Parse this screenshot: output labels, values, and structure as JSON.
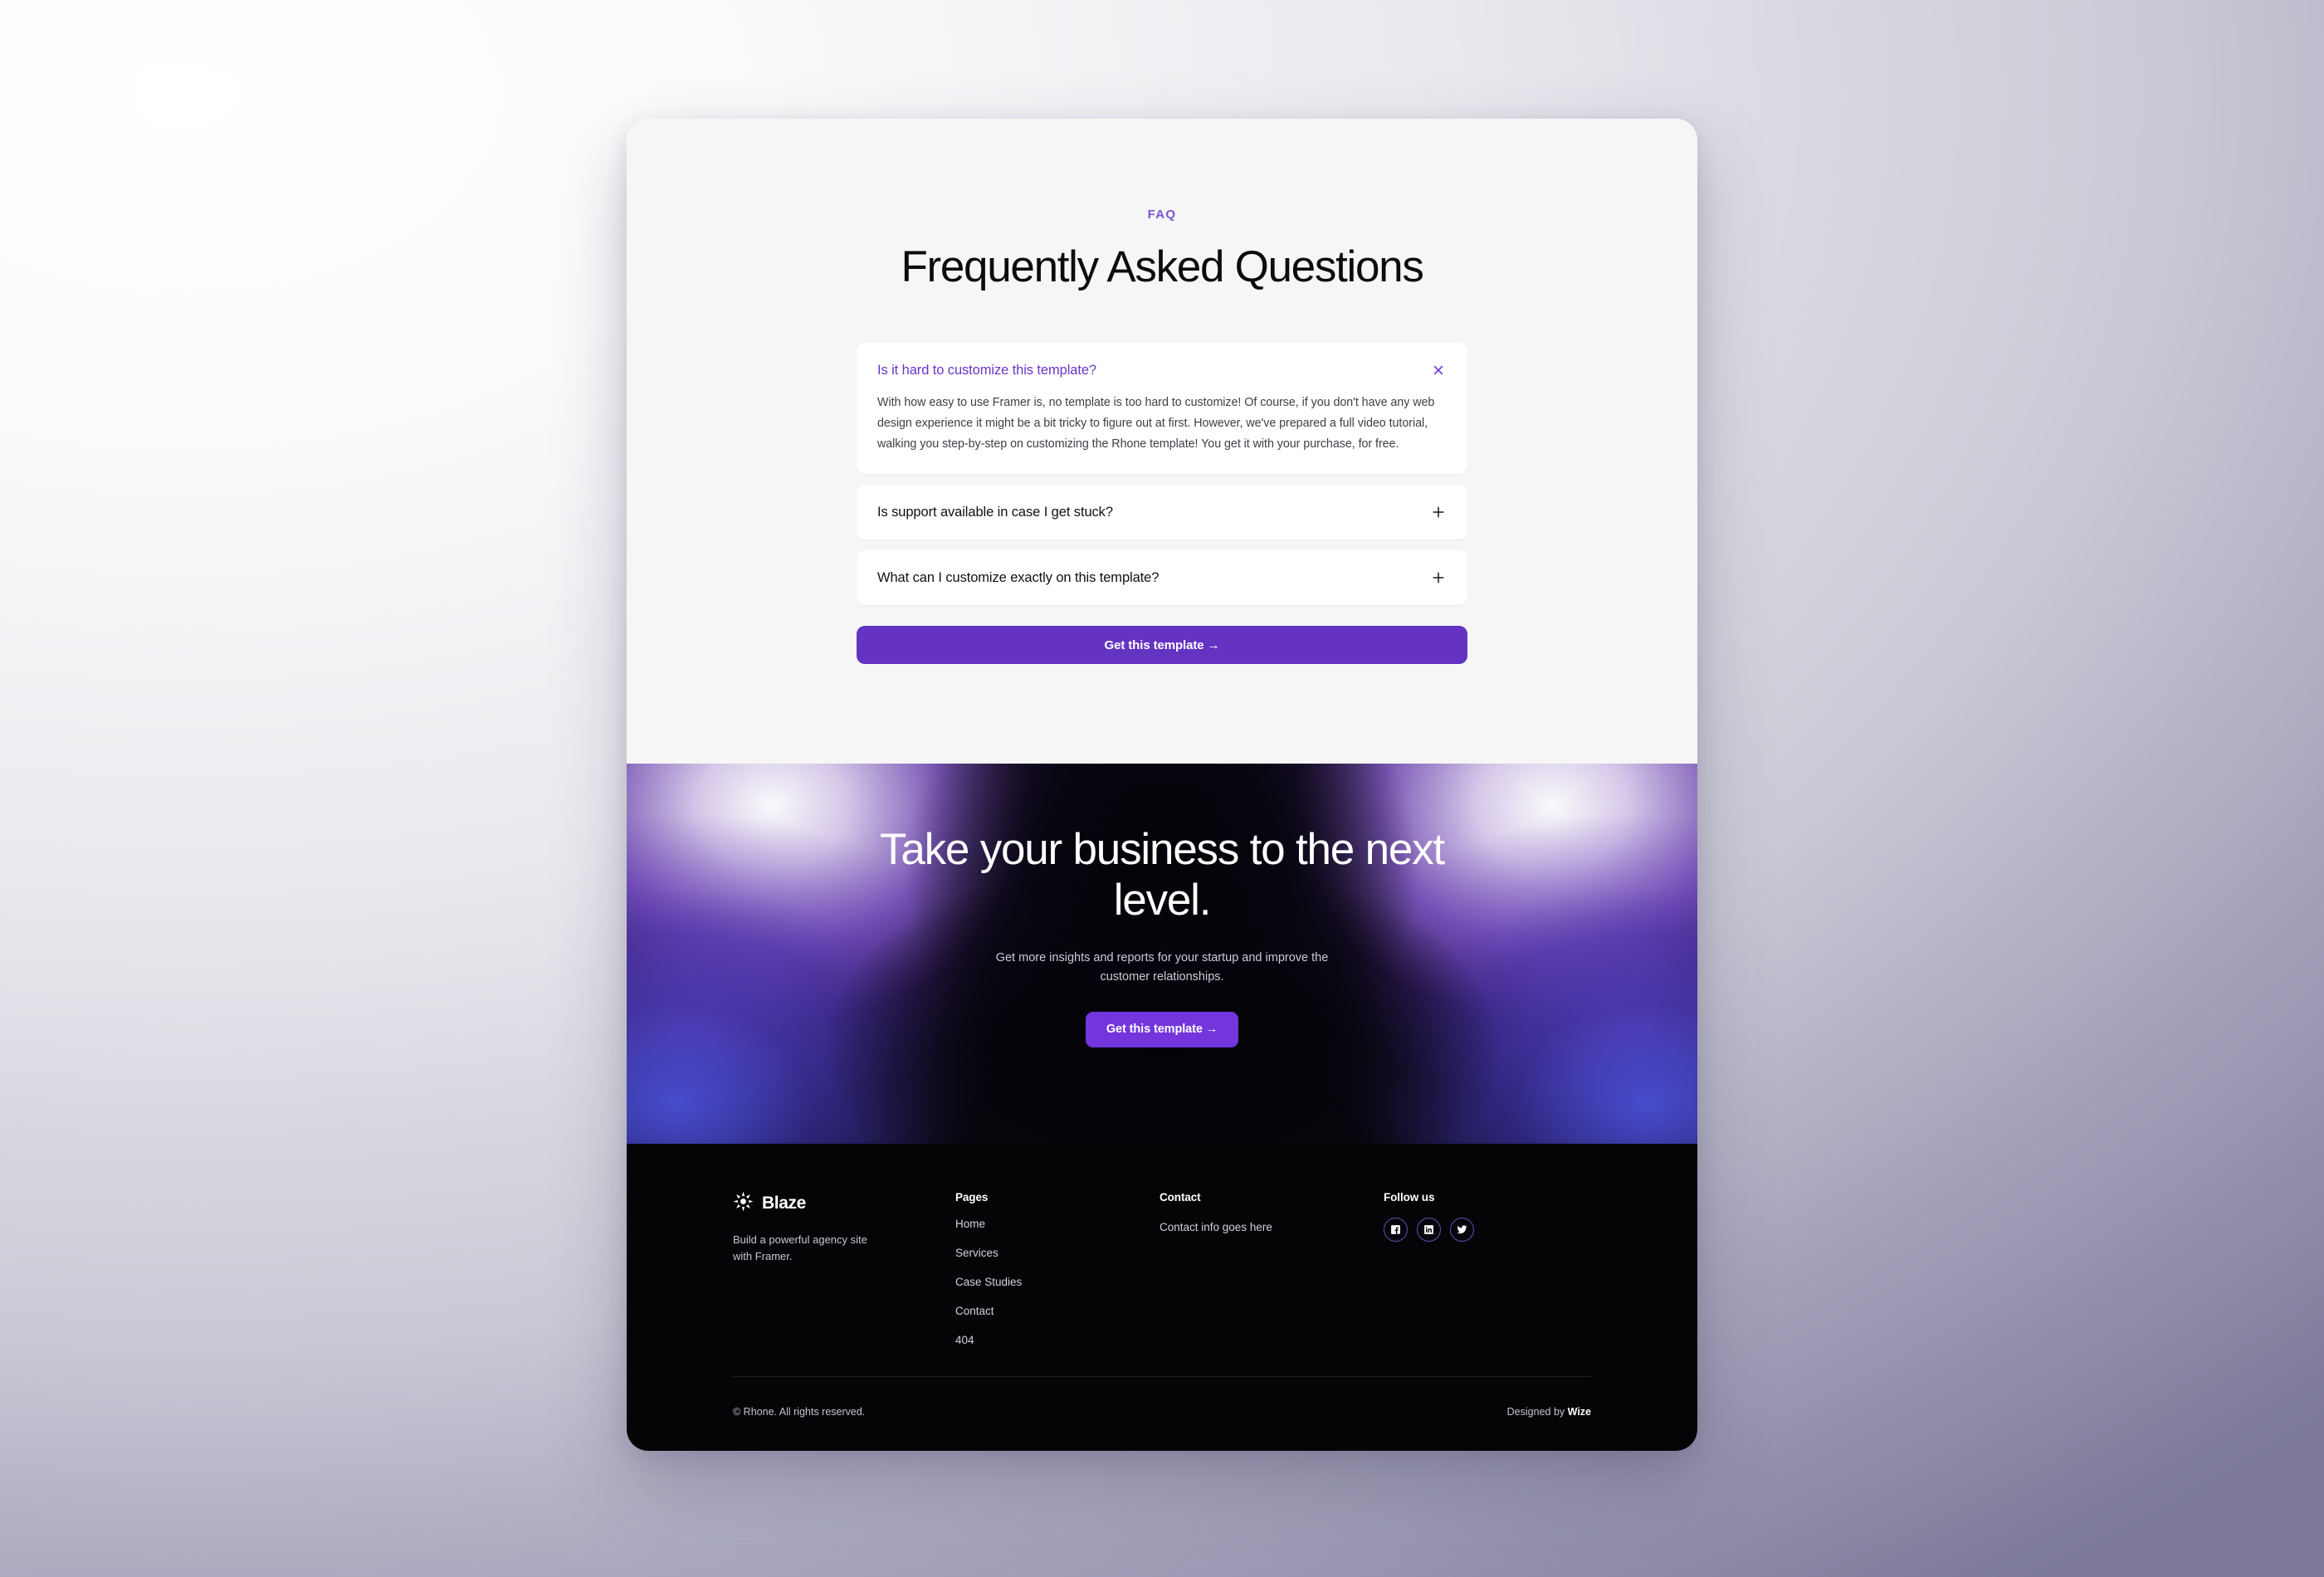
{
  "faq": {
    "eyebrow": "FAQ",
    "title": "Frequently Asked Questions",
    "items": [
      {
        "question": "Is it hard to customize this template?",
        "answer": "With how easy to use Framer is, no template is too hard to customize! Of course, if you don't have any web design experience it might be a bit tricky to figure out at first. However, we've prepared a full video tutorial, walking you step-by-step on customizing the Rhone template! You get it with your purchase, for free.",
        "state": "open",
        "icon": "close-icon"
      },
      {
        "question": "Is support available in case I get stuck?",
        "state": "closed",
        "icon": "plus-icon"
      },
      {
        "question": "What can I customize exactly on this template?",
        "state": "closed",
        "icon": "plus-icon"
      }
    ],
    "cta_label": "Get this template →"
  },
  "cta": {
    "title": "Take your business to the next level.",
    "subtitle": "Get more insights and reports for your startup and improve the customer relationships.",
    "button_label": "Get this template →"
  },
  "footer": {
    "brand": {
      "logo_icon": "sun-burst-icon",
      "name": "Blaze",
      "tagline": "Build a powerful agency site with Framer."
    },
    "pages": {
      "title": "Pages",
      "links": [
        "Home",
        "Services",
        "Case Studies",
        "Contact",
        "404"
      ]
    },
    "contact": {
      "title": "Contact",
      "info": "Contact info goes here"
    },
    "follow": {
      "title": "Follow us",
      "socials": [
        "facebook-icon",
        "linkedin-icon",
        "twitter-icon"
      ]
    },
    "copyright": "© Rhone. All rights reserved.",
    "designed_by_prefix": "Designed by ",
    "designed_by_name": "Wize"
  },
  "colors": {
    "accent_purple": "#6433c2",
    "cta_purple": "#7435dd",
    "eyebrow_purple": "#7b54d4",
    "open_question_purple": "#6a35c8",
    "footer_bg": "#050508",
    "card_bg": "#f6f6f7"
  }
}
